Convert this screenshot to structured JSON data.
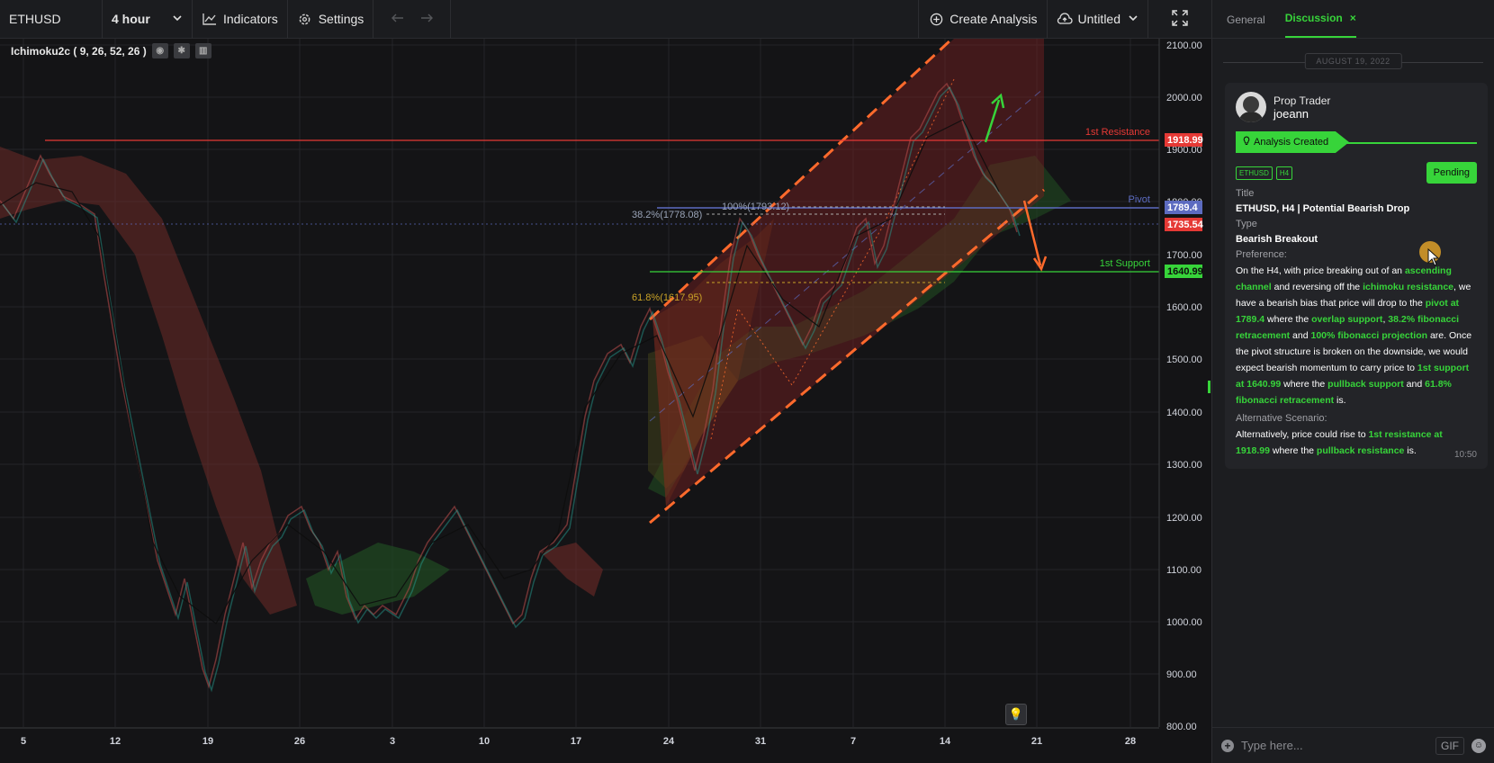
{
  "toolbar": {
    "symbol": "ETHUSD",
    "interval": "4 hour",
    "indicators": "Indicators",
    "settings": "Settings",
    "create_analysis": "Create Analysis",
    "layout_name": "Untitled"
  },
  "indicator": {
    "label": "Ichimoku2c ( 9, 26, 52, 26 )"
  },
  "chart": {
    "price_axis": [
      "2100.00",
      "2000.00",
      "1900.00",
      "1800.00",
      "1700.00",
      "1600.00",
      "1500.00",
      "1400.00",
      "1300.00",
      "1200.00",
      "1100.00",
      "1000.00",
      "900.00",
      "800.00"
    ],
    "time_axis": [
      "5",
      "12",
      "19",
      "26",
      "3",
      "10",
      "17",
      "24",
      "31",
      "7",
      "14",
      "21",
      "28"
    ],
    "level_labels": {
      "resistance": "1st Resistance",
      "pivot": "Pivot",
      "support": "1st Support"
    },
    "price_tags": {
      "resistance": "1918.99",
      "pivot": "1789.4",
      "current": "1735.54",
      "support": "1640.99"
    },
    "fib_labels": {
      "f382": "38.2%(1778.08)",
      "f100": "100%(1793.12)",
      "f618": "61.8%(1617.95)"
    },
    "colors": {
      "up": "#26a69a",
      "down": "#ef5350",
      "resistance": "#e53935",
      "pivot": "#5c6bc0",
      "support": "#37d43a",
      "channel": "#ff6a2c"
    }
  },
  "panel": {
    "tabs": {
      "general": "General",
      "discussion": "Discussion"
    },
    "date": "AUGUST 19, 2022",
    "author": {
      "role": "Prop Trader",
      "name": "joeann"
    },
    "status": "Analysis Created",
    "badges": [
      "ETHUSD",
      "H4"
    ],
    "pending": "Pending",
    "title_label": "Title",
    "title_value": "ETHUSD, H4 | Potential Bearish Drop",
    "type_label": "Type",
    "type_value": "Bearish Breakout",
    "preference_label": "Preference:",
    "preference": {
      "t1": "On the H4, with price breaking out of an ",
      "g1": "ascending channel",
      "t2": " and reversing off the ",
      "g2": "ichimoku resistance",
      "t3": ", we have a bearish bias that price will drop to the ",
      "g3": "pivot at 1789.4",
      "t4": " where the ",
      "g4": "overlap support",
      "t5": ", ",
      "g5": "38.2% fibonacci retracement",
      "t6": " and ",
      "g6": "100% fibonacci projection",
      "t7": " are. Once the pivot structure is broken on the downside, we would expect bearish momentum to carry price to ",
      "g7": "1st support at 1640.99",
      "t8": " where the ",
      "g8": "pullback support",
      "t9": " and ",
      "g9": "61.8% fibonacci retracement",
      "t10": " is."
    },
    "alternative_label": "Alternative Scenario:",
    "alternative": {
      "t1": "Alternatively, price could rise to ",
      "g1": "1st resistance at 1918.99",
      "t2": " where the ",
      "g2": "pullback resistance",
      "t3": " is."
    },
    "time": "10:50",
    "composer": {
      "placeholder": "Type here...",
      "gif": "GIF"
    }
  }
}
